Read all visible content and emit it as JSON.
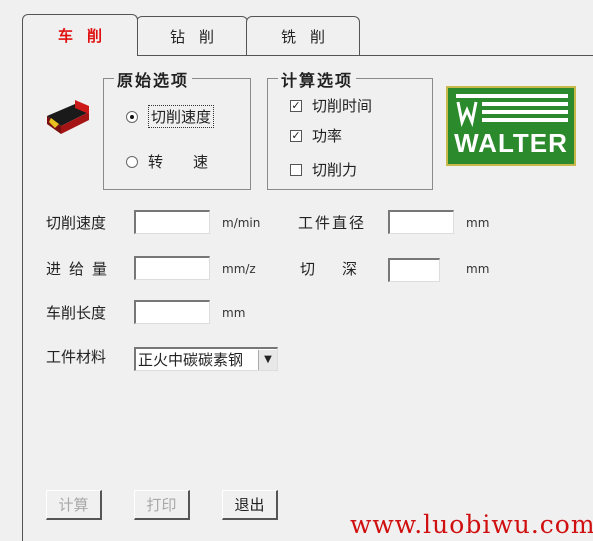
{
  "tabs": [
    {
      "label": "车削",
      "active": true
    },
    {
      "label": "钻削",
      "active": false
    },
    {
      "label": "铣削",
      "active": false
    }
  ],
  "original_options": {
    "title": "原始选项",
    "items": [
      {
        "label": "切削速度",
        "selected": true
      },
      {
        "label": "转　　速",
        "selected": false
      }
    ]
  },
  "calc_options": {
    "title": "计算选项",
    "items": [
      {
        "label": "切削时间",
        "checked": true
      },
      {
        "label": "功率",
        "checked": true
      },
      {
        "label": "切削力",
        "checked": false
      }
    ]
  },
  "logo": {
    "text": "WALTER",
    "bg_color": "#2b8a2b",
    "text_color": "#ffffff"
  },
  "fields": {
    "cutting_speed": {
      "label": "切削速度",
      "value": "",
      "unit": "m/min"
    },
    "workpiece_diameter": {
      "label": "工件直径",
      "value": "",
      "unit": "mm"
    },
    "feed": {
      "label": "进给量",
      "value": "",
      "unit": "mm/z"
    },
    "depth_of_cut": {
      "label": "切　深",
      "value": "",
      "unit": "mm"
    },
    "turning_length": {
      "label": "车削长度",
      "value": "",
      "unit": "mm"
    }
  },
  "material": {
    "label": "工件材料",
    "selected": "正火中碳碳素钢"
  },
  "buttons": {
    "calculate": "计算",
    "print": "打印",
    "exit": "退出"
  },
  "watermark": "www.luobiwu.com",
  "colors": {
    "active_tab_text": "#e01010",
    "watermark": "#d01010"
  }
}
